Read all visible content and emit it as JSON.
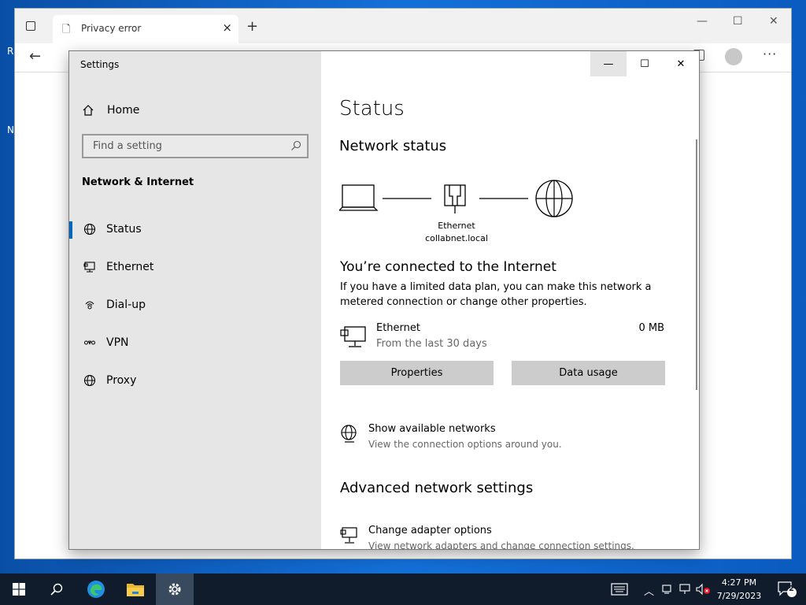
{
  "desktop": {
    "letters": [
      "R",
      "N"
    ]
  },
  "edge": {
    "tab_title": "Privacy error",
    "tab_close": "×",
    "new_tab": "+",
    "ctl_min": "—",
    "ctl_max": "☐",
    "ctl_close": "✕",
    "back": "←",
    "more": "···"
  },
  "settings": {
    "app_title": "Settings",
    "window_controls": {
      "minimize": "—",
      "maximize": "☐",
      "close": "✕"
    },
    "sidebar": {
      "home_label": "Home",
      "search_placeholder": "Find a setting",
      "section_title": "Network & Internet",
      "items": [
        {
          "label": "Status",
          "icon": "status-globe-icon",
          "active": true
        },
        {
          "label": "Ethernet",
          "icon": "ethernet-icon",
          "active": false
        },
        {
          "label": "Dial-up",
          "icon": "dialup-icon",
          "active": false
        },
        {
          "label": "VPN",
          "icon": "vpn-icon",
          "active": false
        },
        {
          "label": "Proxy",
          "icon": "globe-icon",
          "active": false
        }
      ]
    },
    "content": {
      "page_title": "Status",
      "network_status_title": "Network status",
      "diagram": {
        "adapter_name": "Ethernet",
        "network_name": "collabnet.local"
      },
      "connected_title": "You’re connected to the Internet",
      "connected_desc": "If you have a limited data plan, you can make this network a metered connection or change other properties.",
      "ethernet": {
        "name": "Ethernet",
        "period": "From the last 30 days",
        "usage": "0 MB"
      },
      "properties_button": "Properties",
      "data_usage_button": "Data usage",
      "show_networks": {
        "title": "Show available networks",
        "sub": "View the connection options around you."
      },
      "advanced_title": "Advanced network settings",
      "change_adapter": {
        "title": "Change adapter options",
        "sub": "View network adapters and change connection settings."
      }
    }
  },
  "taskbar": {
    "clock_time": "4:27 PM",
    "clock_date": "7/29/2023",
    "notification_count": "2",
    "accent": "#0067c0"
  }
}
